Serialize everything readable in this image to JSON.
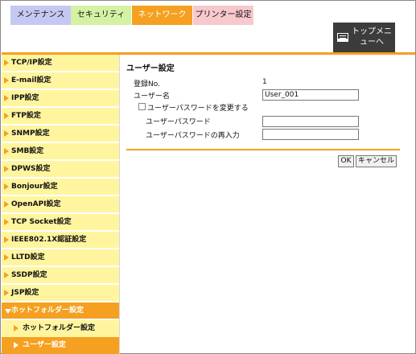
{
  "tabs": {
    "maintenance": "メンテナンス",
    "security": "セキュリティ",
    "network": "ネットワーク",
    "printer": "プリンター設定"
  },
  "top_menu": {
    "label": "トップメニューへ",
    "icon": "display-icon"
  },
  "sidebar": {
    "items": [
      {
        "label": "TCP/IP設定"
      },
      {
        "label": "E-mail設定"
      },
      {
        "label": "IPP設定"
      },
      {
        "label": "FTP設定"
      },
      {
        "label": "SNMP設定"
      },
      {
        "label": "SMB設定"
      },
      {
        "label": "DPWS設定"
      },
      {
        "label": "Bonjour設定"
      },
      {
        "label": "OpenAPI設定"
      },
      {
        "label": "TCP Socket設定"
      },
      {
        "label": "IEEE802.1X認証設定"
      },
      {
        "label": "LLTD設定"
      },
      {
        "label": "SSDP設定"
      },
      {
        "label": "JSP設定"
      },
      {
        "label": "ホットフォルダー設定"
      }
    ],
    "sub_items": [
      {
        "label": "ホットフォルダー設定"
      },
      {
        "label": "ユーザー設定"
      }
    ]
  },
  "main": {
    "section_title": "ユーザー設定",
    "reg_no_label": "登録No.",
    "reg_no_value": "1",
    "user_name_label": "ユーザー名",
    "user_name_value": "User_001",
    "change_password_label": "ユーザーパスワードを変更する",
    "password_label": "ユーザーパスワード",
    "password_value": "",
    "password_confirm_label": "ユーザーパスワードの再入力",
    "password_confirm_value": "",
    "ok_label": "OK",
    "cancel_label": "キャンセル"
  },
  "colors": {
    "accent": "#f5a020",
    "sidebar_bg": "#fff59f",
    "tab_maintenance": "#c5c8f2",
    "tab_security": "#d5f2a4",
    "tab_printer": "#f8c8cc"
  }
}
